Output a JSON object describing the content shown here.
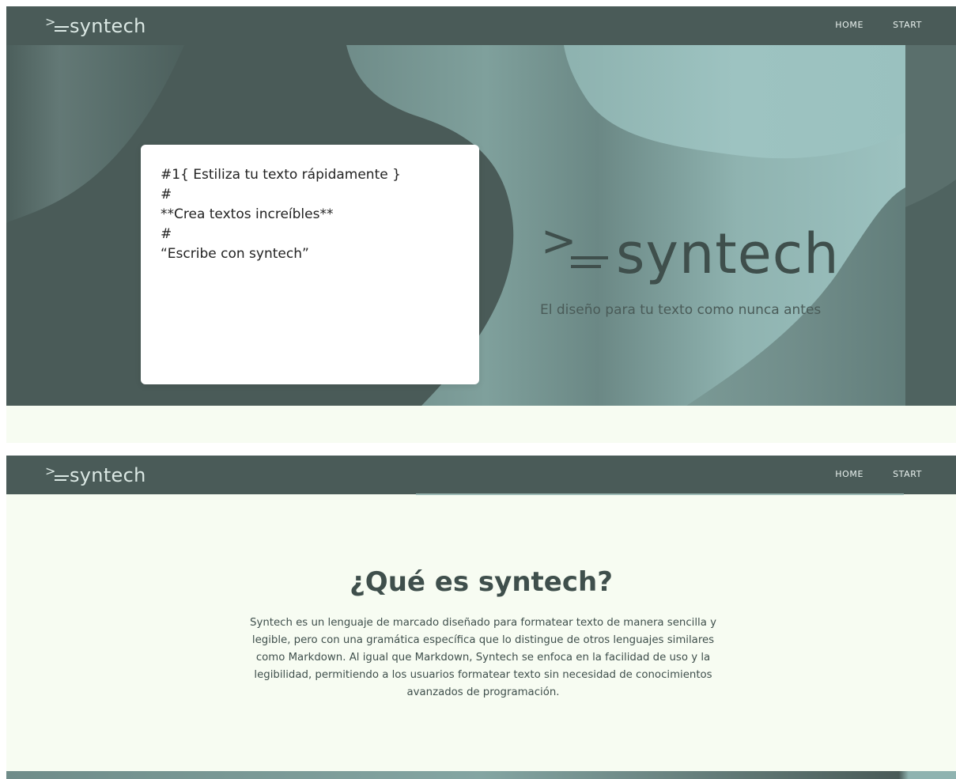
{
  "nav": {
    "logo_text": "syntech",
    "links": [
      {
        "label": "HOME"
      },
      {
        "label": "START"
      }
    ]
  },
  "hero": {
    "editor_lines": [
      "#1{ Estiliza tu texto rápidamente }",
      "#",
      "**Crea textos increíbles**",
      "#",
      "“Escribe con syntech”"
    ],
    "brand_text": "syntech",
    "tagline": "El diseño para tu texto como nunca antes"
  },
  "about": {
    "title": "¿Qué es syntech?",
    "body": "Syntech es un lenguaje de marcado diseñado para formatear texto de manera sencilla y legible, pero con una gramática específica que lo distingue de otros lenguajes similares como Markdown. Al igual que Markdown, Syntech se enfoca en la facilidad de uso y la legibilidad, permitiendo a los usuarios formatear texto sin necesidad de conocimientos avanzados de programación."
  },
  "icons": {
    "logo": "syntech-logo-icon"
  },
  "colors": {
    "nav_bg": "#4a5b58",
    "page_bg": "#f7fcf2",
    "text_dark": "#3f4f4c",
    "accent": "#8fb6b3"
  }
}
